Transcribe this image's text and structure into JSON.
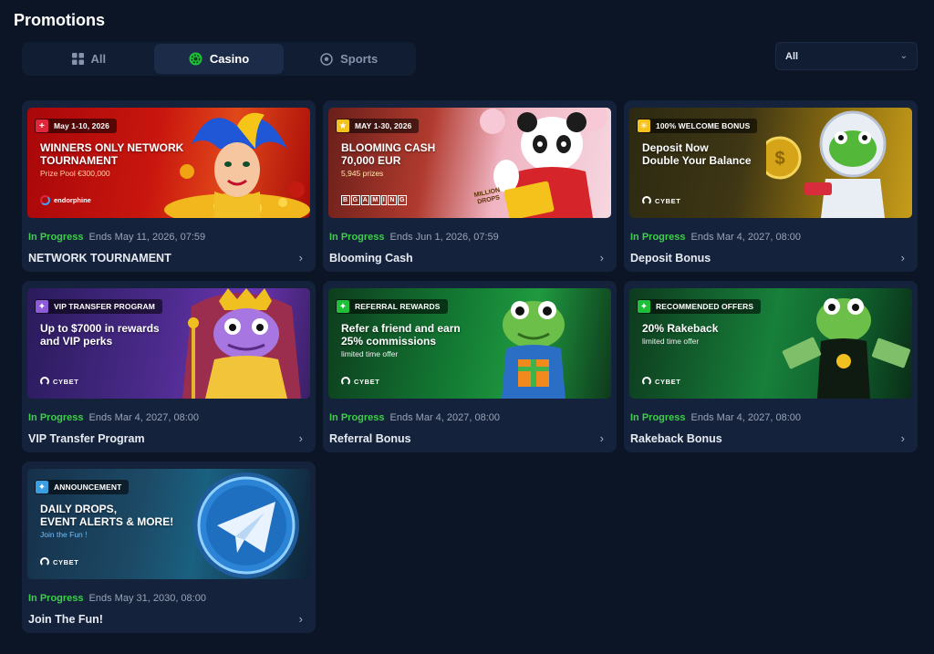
{
  "header": {
    "title": "Promotions"
  },
  "tabs": [
    {
      "label": "All",
      "icon": "grid-icon"
    },
    {
      "label": "Casino",
      "icon": "casino-chip-icon",
      "active": true
    },
    {
      "label": "Sports",
      "icon": "soccer-ball-icon"
    }
  ],
  "filter": {
    "selected": "All"
  },
  "colors": {
    "background": "#0c1526",
    "card": "#15223b",
    "status_green": "#3ecf4a",
    "muted": "#9aa3b6"
  },
  "cards": [
    {
      "tag": "May 1-10, 2026",
      "heading": "WINNERS ONLY NETWORK\nTOURNAMENT",
      "sub": "Prize Pool €300,000",
      "brand": "endorphine",
      "status": "In Progress",
      "ends": "Ends May 11, 2026, 07:59",
      "title": "NETWORK TOURNAMENT"
    },
    {
      "tag": "MAY 1-30, 2026",
      "heading": "BLOOMING CASH\n70,000 EUR",
      "sub": "5,945 prizes",
      "brand": "BGAMING",
      "art_text": "MILLION DROPS",
      "status": "In Progress",
      "ends": "Ends Jun 1, 2026, 07:59",
      "title": "Blooming Cash"
    },
    {
      "tag": "100% WELCOME BONUS",
      "heading": "Deposit Now\nDouble Your Balance",
      "brand": "CYBET",
      "status": "In Progress",
      "ends": "Ends Mar 4, 2027, 08:00",
      "title": "Deposit Bonus"
    },
    {
      "tag": "VIP TRANSFER PROGRAM",
      "heading": "Up to $7000 in rewards\nand VIP perks",
      "brand": "CYBET",
      "status": "In Progress",
      "ends": "Ends Mar 4, 2027, 08:00",
      "title": "VIP Transfer Program"
    },
    {
      "tag": "REFERRAL REWARDS",
      "heading": "Refer a friend and earn\n25% commissions",
      "sub": "limited time offer",
      "brand": "CYBET",
      "status": "In Progress",
      "ends": "Ends Mar 4, 2027, 08:00",
      "title": "Referral Bonus"
    },
    {
      "tag": "RECOMMENDED OFFERS",
      "heading": "20% Rakeback",
      "sub": "limited time offer",
      "brand": "CYBET",
      "status": "In Progress",
      "ends": "Ends Mar 4, 2027, 08:00",
      "title": "Rakeback Bonus"
    },
    {
      "tag": "ANNOUNCEMENT",
      "heading": "DAILY DROPS,\nEVENT ALERTS & MORE!",
      "sub": "Join the Fun !",
      "brand": "CYBET",
      "status": "In Progress",
      "ends": "Ends May 31, 2030, 08:00",
      "title": "Join The Fun!"
    }
  ]
}
